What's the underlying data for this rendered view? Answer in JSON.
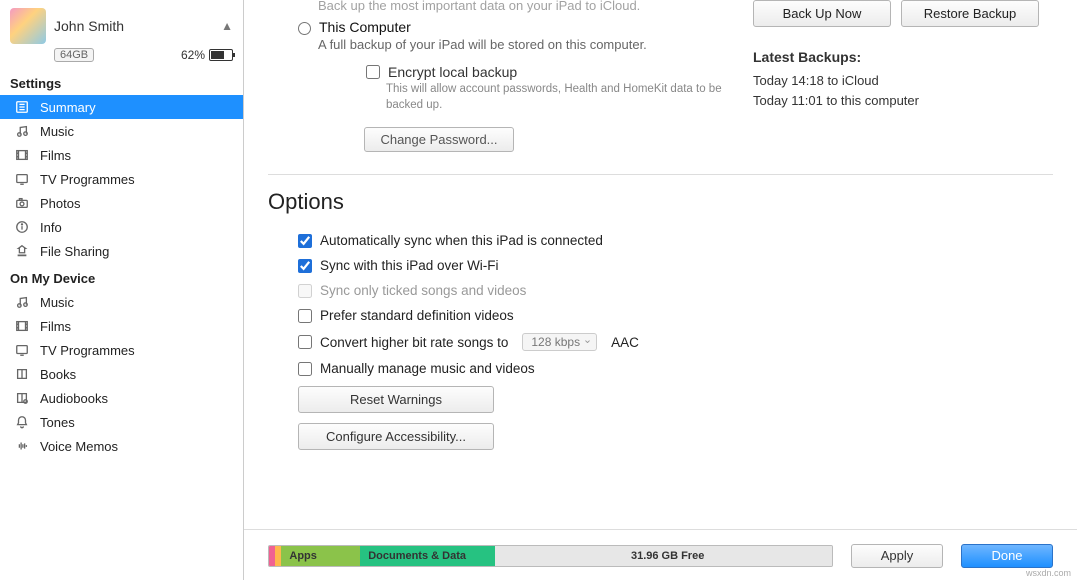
{
  "device": {
    "name": "John Smith",
    "capacity": "64GB",
    "battery_pct": "62%"
  },
  "sidebar": {
    "settings_header": "Settings",
    "settings_items": [
      {
        "key": "summary",
        "label": "Summary",
        "icon": "summary-icon",
        "selected": true
      },
      {
        "key": "music",
        "label": "Music",
        "icon": "music-icon"
      },
      {
        "key": "films",
        "label": "Films",
        "icon": "film-icon"
      },
      {
        "key": "tv",
        "label": "TV Programmes",
        "icon": "tv-icon"
      },
      {
        "key": "photos",
        "label": "Photos",
        "icon": "camera-icon"
      },
      {
        "key": "info",
        "label": "Info",
        "icon": "info-icon"
      },
      {
        "key": "fileshare",
        "label": "File Sharing",
        "icon": "fileshare-icon"
      }
    ],
    "device_header": "On My Device",
    "device_items": [
      {
        "key": "d-music",
        "label": "Music",
        "icon": "music-icon"
      },
      {
        "key": "d-films",
        "label": "Films",
        "icon": "film-icon"
      },
      {
        "key": "d-tv",
        "label": "TV Programmes",
        "icon": "tv-icon"
      },
      {
        "key": "d-books",
        "label": "Books",
        "icon": "book-icon"
      },
      {
        "key": "d-audiobooks",
        "label": "Audiobooks",
        "icon": "audiobook-icon"
      },
      {
        "key": "d-tones",
        "label": "Tones",
        "icon": "bell-icon"
      },
      {
        "key": "d-voice",
        "label": "Voice Memos",
        "icon": "voicememo-icon"
      }
    ]
  },
  "backups": {
    "top_truncated": "Back up the most important data on your iPad to iCloud.",
    "this_computer_label": "This Computer",
    "this_computer_desc": "A full backup of your iPad will be stored on this computer.",
    "encrypt_label": "Encrypt local backup",
    "encrypt_desc": "This will allow account passwords, Health and HomeKit data to be backed up.",
    "change_pwd_btn": "Change Password...",
    "backup_now_btn": "Back Up Now",
    "restore_btn": "Restore Backup",
    "latest_header": "Latest Backups:",
    "latest_lines": [
      "Today 14:18 to iCloud",
      "Today 11:01 to this computer"
    ]
  },
  "options": {
    "title": "Options",
    "items": [
      {
        "key": "autosync",
        "label": "Automatically sync when this iPad is connected",
        "checked": true
      },
      {
        "key": "wifi",
        "label": "Sync with this iPad over Wi-Fi",
        "checked": true
      },
      {
        "key": "tickedonly",
        "label": "Sync only ticked songs and videos",
        "checked": false,
        "disabled": true
      },
      {
        "key": "sdvideo",
        "label": "Prefer standard definition videos",
        "checked": false
      },
      {
        "key": "bitrate_prefix",
        "label": "Convert higher bit rate songs to",
        "checked": false,
        "bitrate": "128 kbps",
        "suffix": "AAC"
      },
      {
        "key": "manual",
        "label": "Manually manage music and videos",
        "checked": false
      }
    ],
    "reset_btn": "Reset Warnings",
    "accessibility_btn": "Configure Accessibility..."
  },
  "footer": {
    "segments": {
      "apps": "Apps",
      "docs": "Documents & Data",
      "free": "31.96 GB Free"
    },
    "apply_btn": "Apply",
    "done_btn": "Done",
    "watermark": "wsxdn.com"
  }
}
